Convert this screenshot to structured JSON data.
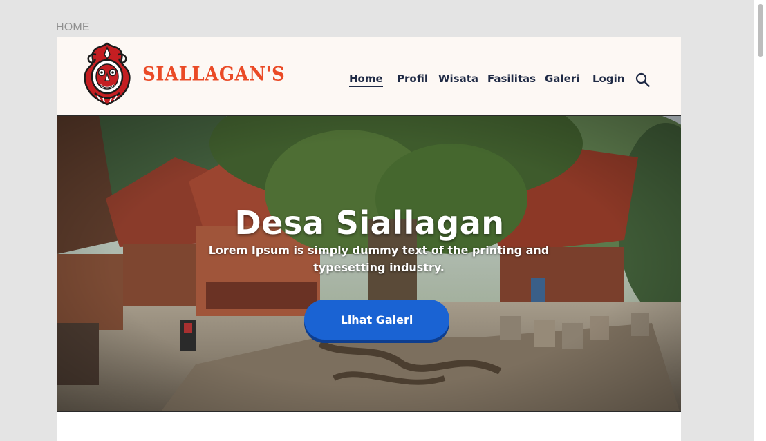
{
  "frame": {
    "label": "HOME"
  },
  "brand": {
    "name": "SIALLAGAN'S",
    "color": "#ea4a26",
    "logo_icon": "batak-ornament-logo"
  },
  "nav": {
    "items": [
      {
        "label": "Home",
        "active": true
      },
      {
        "label": "Profil",
        "active": false
      },
      {
        "label": "Wisata",
        "active": false
      },
      {
        "label": "Fasilitas",
        "active": false
      },
      {
        "label": "Galeri",
        "active": false
      },
      {
        "label": "Login",
        "active": false
      }
    ],
    "search_icon": "search-icon"
  },
  "hero": {
    "title": "Desa Siallagan",
    "subtitle": "Lorem Ipsum is simply dummy text of the printing and typesetting industry.",
    "button_label": "Lihat Galeri",
    "button_color": "#1a63d3"
  },
  "colors": {
    "nav_text": "#1f2a45",
    "header_bg": "#fdf8f4",
    "canvas_bg": "#e4e4e4"
  }
}
